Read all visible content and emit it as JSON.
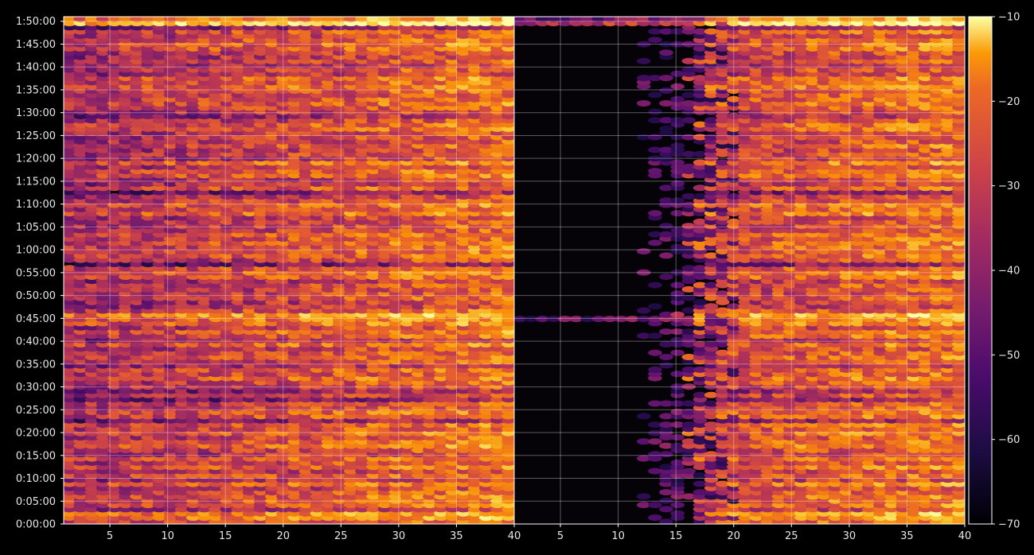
{
  "chart_data": {
    "type": "heatmap",
    "panels": [
      {
        "name": "",
        "x_tick_labels": [
          "5",
          "10",
          "15",
          "20",
          "25",
          "30",
          "35",
          "40"
        ],
        "x_range": [
          1,
          40
        ]
      },
      {
        "name": "",
        "x_tick_labels": [
          "5",
          "10",
          "15",
          "20",
          "25",
          "30",
          "35",
          "40"
        ],
        "x_range": [
          1,
          40
        ]
      }
    ],
    "y_tick_labels": [
      "0:00:00",
      "0:05:00",
      "0:10:00",
      "0:15:00",
      "0:20:00",
      "0:25:00",
      "0:30:00",
      "0:35:00",
      "0:40:00",
      "0:45:00",
      "0:50:00",
      "0:55:00",
      "1:00:00",
      "1:05:00",
      "1:10:00",
      "1:15:00",
      "1:20:00",
      "1:25:00",
      "1:30:00",
      "1:35:00",
      "1:40:00",
      "1:45:00",
      "1:50:00"
    ],
    "y_range_minutes": [
      0,
      111
    ],
    "colorbar": {
      "colormap": "inferno",
      "range": [
        -70,
        -10
      ],
      "tick_labels": [
        "−10",
        "−20",
        "−30",
        "−40",
        "−50",
        "−60",
        "−70"
      ]
    },
    "grid": true,
    "note_right_panel_dark_region": {
      "x_max": 15,
      "description": ""
    }
  }
}
